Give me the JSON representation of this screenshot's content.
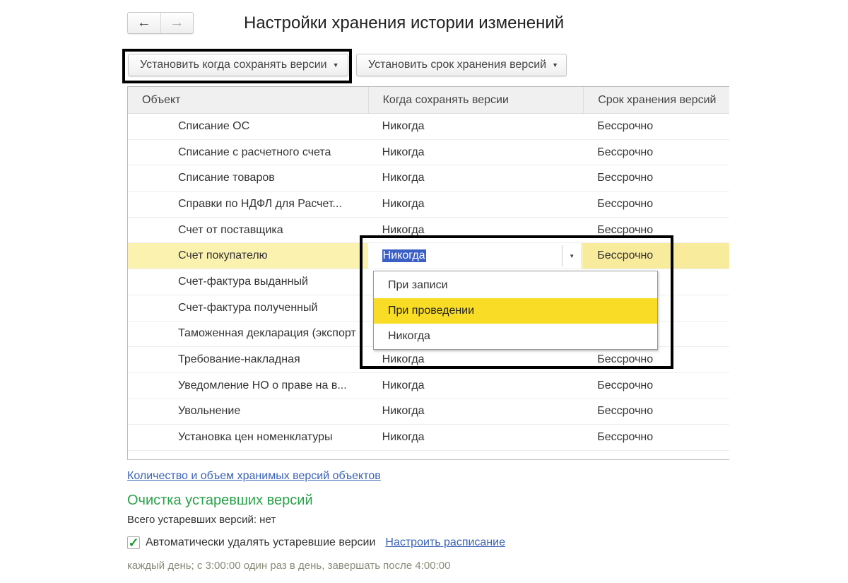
{
  "header": {
    "back": "🡐",
    "forward": "🡒",
    "title": "Настройки хранения истории изменений"
  },
  "toolbar": {
    "set_when": "Установить когда сохранять версии",
    "set_term": "Установить срок хранения версий",
    "caret": "▼"
  },
  "table": {
    "columns": [
      "Объект",
      "Когда сохранять версии",
      "Срок хранения версий"
    ],
    "rows": [
      [
        "Списание ОС",
        "Никогда",
        "Бессрочно"
      ],
      [
        "Списание с расчетного счета",
        "Никогда",
        "Бессрочно"
      ],
      [
        "Списание товаров",
        "Никогда",
        "Бессрочно"
      ],
      [
        "Справки по НДФЛ для Расчет...",
        "Никогда",
        "Бессрочно"
      ],
      [
        "Счет от поставщика",
        "Никогда",
        "Бессрочно"
      ],
      [
        "Счет покупателю",
        "Никогда",
        "Бессрочно"
      ],
      [
        "Счет-фактура выданный",
        "",
        ""
      ],
      [
        "Счет-фактура полученный",
        "",
        ""
      ],
      [
        "Таможенная декларация (экспорт",
        "",
        ""
      ],
      [
        "Требование-накладная",
        "Никогда",
        "Бессрочно"
      ],
      [
        "Уведомление НО о праве на в...",
        "Никогда",
        "Бессрочно"
      ],
      [
        "Увольнение",
        "Никогда",
        "Бессрочно"
      ],
      [
        "Установка цен номенклатуры",
        "Никогда",
        "Бессрочно"
      ]
    ],
    "selected_row": 5
  },
  "dropdown": {
    "options": [
      "При записи",
      "При проведении",
      "Никогда"
    ],
    "highlighted": 1
  },
  "footer": {
    "versions_link": "Количество и объем хранимых версий объектов",
    "cleanup_title": "Очистка устаревших версий",
    "total_outdated": "Всего устаревших версий: нет",
    "auto_delete_label": "Автоматически удалять устаревшие версии",
    "auto_delete_checked": true,
    "checkmark": "✓",
    "schedule_link": "Настроить расписание",
    "schedule_text": "каждый день; с 3:00:00 один раз в день, завершать после 4:00:00"
  }
}
